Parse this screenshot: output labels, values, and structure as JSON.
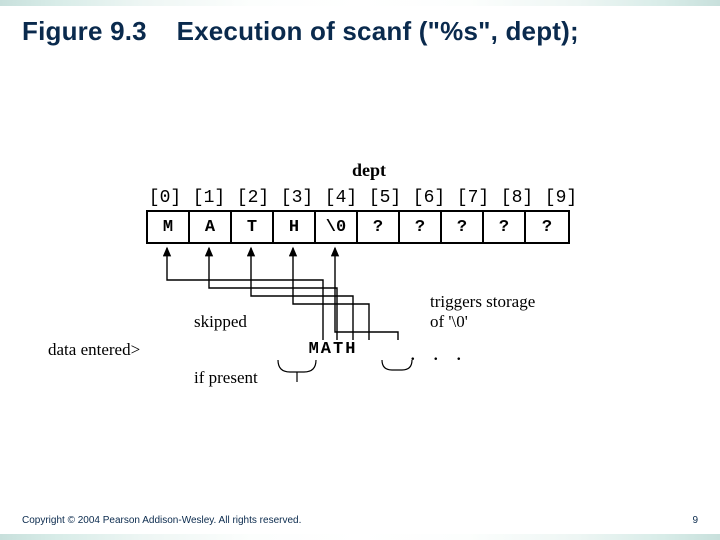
{
  "title": {
    "figno": "Figure 9.3",
    "caption": "Execution of scanf (\"%s\", dept);"
  },
  "footer": {
    "copyright": "Copyright © 2004 Pearson Addison-Wesley. All rights reserved.",
    "page": "9"
  },
  "diagram": {
    "var": "dept",
    "indices": [
      "[0]",
      "[1]",
      "[2]",
      "[3]",
      "[4]",
      "[5]",
      "[6]",
      "[7]",
      "[8]",
      "[9]"
    ],
    "cells": [
      "M",
      "A",
      "T",
      "H",
      "\\0",
      "?",
      "?",
      "?",
      "?",
      "?"
    ],
    "labels": {
      "skipped": "skipped",
      "data_entered": "data entered>",
      "if_present": "if present",
      "triggers_l1": "triggers storage",
      "triggers_l2": "of '\\0'"
    },
    "input": "   MATH",
    "input_chars": {
      "sp": "   ",
      "word": "MATH"
    },
    "dots": ". . ."
  }
}
